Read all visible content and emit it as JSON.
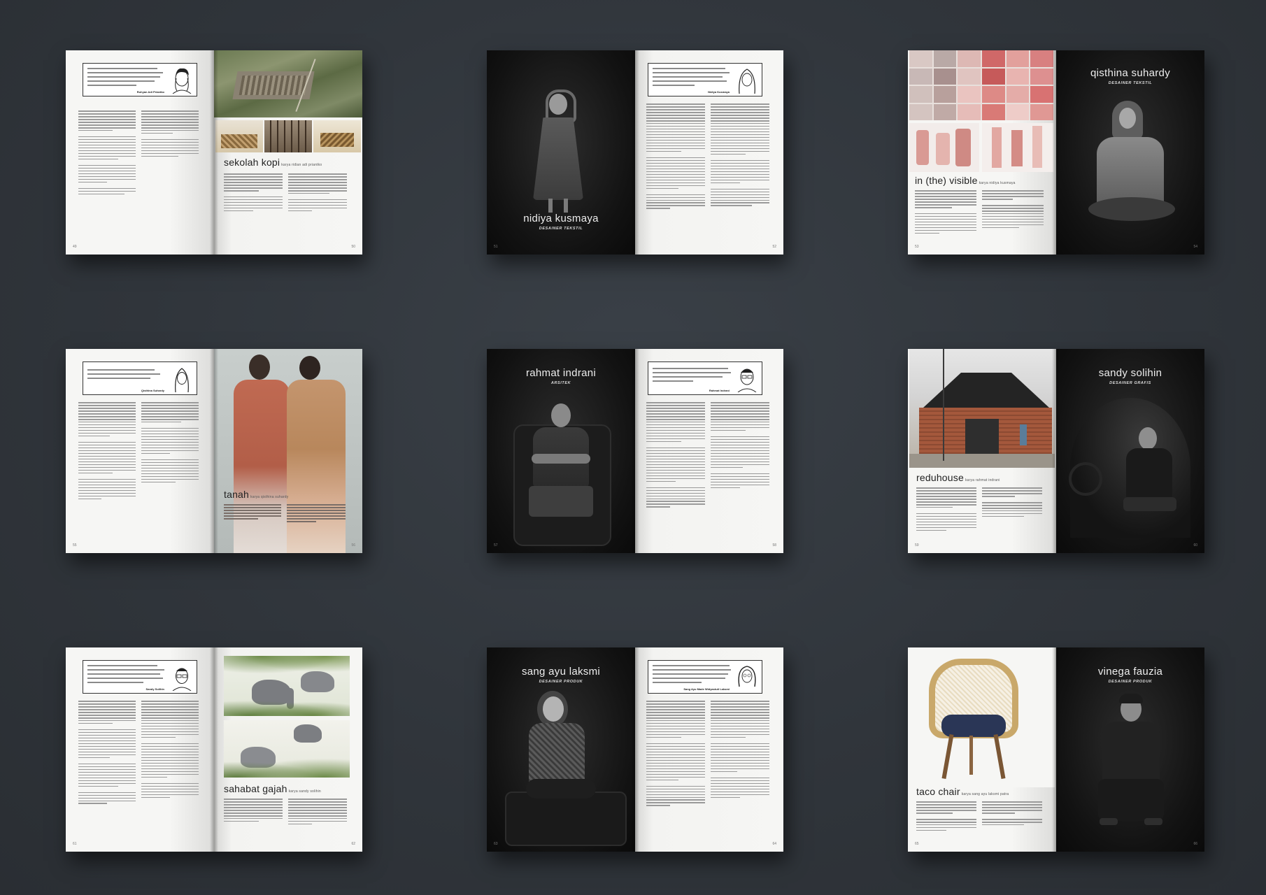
{
  "spreads": [
    {
      "id": "sekolah-kopi",
      "quote_sig": "Ruhyan Adi Priantko",
      "title": "sekolah kopi",
      "subtitle": "karya ridian adi priantko",
      "page_left": "49",
      "page_right": "50"
    },
    {
      "id": "nidiya-kusmaya",
      "name": "nidiya kusmaya",
      "role": "DESAINER TEKSTIL",
      "quote_sig": "Nidiya Kusmaya",
      "page_left": "51",
      "page_right": "52"
    },
    {
      "id": "qisthina-suhardy",
      "title": "in (the) visible",
      "subtitle": "karya nidiya kusmaya",
      "name": "qisthina suhardy",
      "role": "DESAINER TEKSTIL",
      "page_left": "53",
      "page_right": "54"
    },
    {
      "id": "tanah",
      "quote_sig": "Qisthina Suhardy",
      "title": "tanah",
      "subtitle": "karya qisthina suhardy",
      "page_left": "55",
      "page_right": "56"
    },
    {
      "id": "rahmat-indrani",
      "name": "rahmat indrani",
      "role": "ARSITEK",
      "quote_sig": "Rahmat Indrani",
      "page_left": "57",
      "page_right": "58"
    },
    {
      "id": "sandy-solihin",
      "title": "reduhouse",
      "subtitle": "karya rahmat indrani",
      "name": "sandy solihin",
      "role": "DESAINER GRAFIS",
      "page_left": "59",
      "page_right": "60"
    },
    {
      "id": "sahabat-gajah",
      "quote_sig": "Sandy Solihin",
      "title": "sahabat gajah",
      "subtitle": "karya sandy solihin",
      "page_left": "61",
      "page_right": "62"
    },
    {
      "id": "sang-ayu-laksmi",
      "name": "sang ayu laksmi",
      "role": "DESAINER PRODUK",
      "quote_sig": "Sang Ayu Made Widyastuti Laksmi",
      "page_left": "63",
      "page_right": "64"
    },
    {
      "id": "vinega-fauzia",
      "title": "taco chair",
      "subtitle": "karya sang ayu laksmi patra",
      "name": "vinega fauzia",
      "role": "DESAINER PRODUK",
      "page_left": "65",
      "page_right": "66"
    }
  ]
}
